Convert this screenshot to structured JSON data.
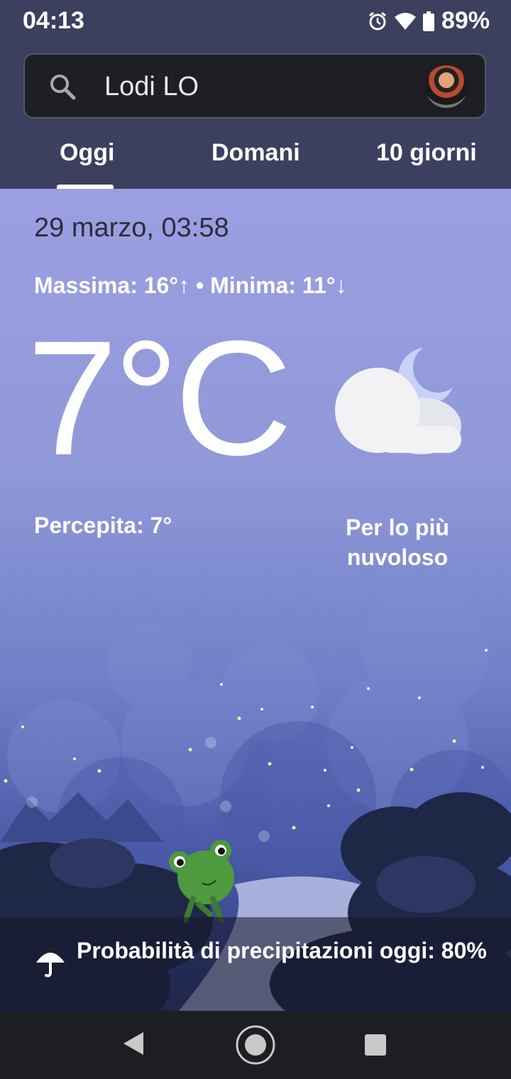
{
  "status_bar": {
    "time": "04:13",
    "battery": "89%",
    "icons": [
      "alarm-icon",
      "wifi-icon",
      "battery-icon"
    ]
  },
  "search": {
    "location": "Lodi LO",
    "icon": "search-icon"
  },
  "tabs": [
    {
      "label": "Oggi",
      "selected": true
    },
    {
      "label": "Domani",
      "selected": false
    },
    {
      "label": "10 giorni",
      "selected": false
    }
  ],
  "weather": {
    "datetime": "29 marzo, 03:58",
    "minmax": "Massima: 16°↑ • Minima: 11°↓",
    "temperature": "7°C",
    "feels_like": "Percepita: 7°",
    "condition": "Per lo più nuvoloso",
    "condition_icon": "partly-cloudy-night-icon"
  },
  "precipitation": {
    "text": "Probabilità di precipitazioni oggi: 80%",
    "icon": "umbrella-icon"
  },
  "colors": {
    "header_bg": "#3d3f5e",
    "sky_top": "#9c9fe2",
    "sky_bottom": "#2e3d7a"
  },
  "navbar": {
    "icons": [
      "back-icon",
      "home-icon",
      "recents-icon"
    ]
  }
}
